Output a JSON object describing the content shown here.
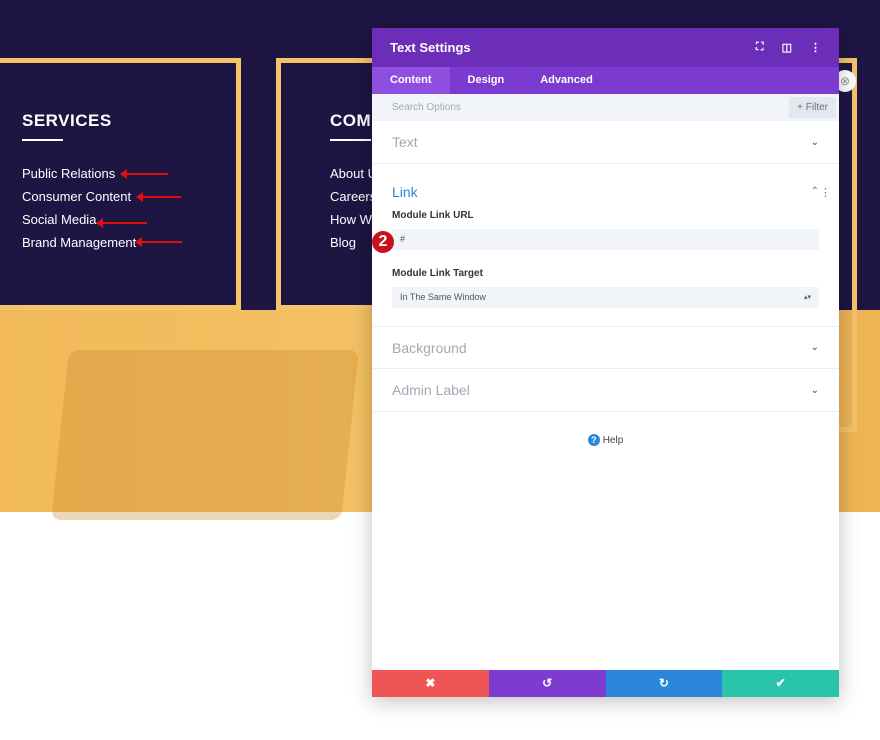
{
  "page": {
    "services": {
      "heading": "SERVICES",
      "links": [
        "Public Relations",
        "Consumer Content",
        "Social Media",
        "Brand Management"
      ]
    },
    "company": {
      "heading": "COMI",
      "links": [
        "About U",
        "Careers",
        "How We",
        "Blog"
      ]
    }
  },
  "modal": {
    "title": "Text Settings",
    "icons": [
      "fullscreen-icon",
      "split-view-icon",
      "more-icon"
    ],
    "tabs": [
      {
        "label": "Content",
        "active": true
      },
      {
        "label": "Design"
      },
      {
        "label": "Advanced"
      }
    ],
    "search_placeholder": "Search Options",
    "filter_label": "+ Filter",
    "sections": {
      "text": "Text",
      "link": "Link",
      "background": "Background",
      "admin": "Admin Label"
    },
    "link": {
      "url_label": "Module Link URL",
      "url_value": "#",
      "target_label": "Module Link Target",
      "target_value": "In The Same Window"
    },
    "help": "Help",
    "footer": {
      "cancel": "✖",
      "undo": "↺",
      "redo": "↻",
      "save": "✔"
    },
    "badge": "2"
  },
  "colors": {
    "header": "#6c2eb9",
    "tabs": "#7b3ad0",
    "cancel": "#ef5555",
    "undo": "#7e3bd0",
    "redo": "#2b87da",
    "save": "#29c4a9",
    "navy": "#1e1543",
    "gold": "#f5c36a"
  }
}
